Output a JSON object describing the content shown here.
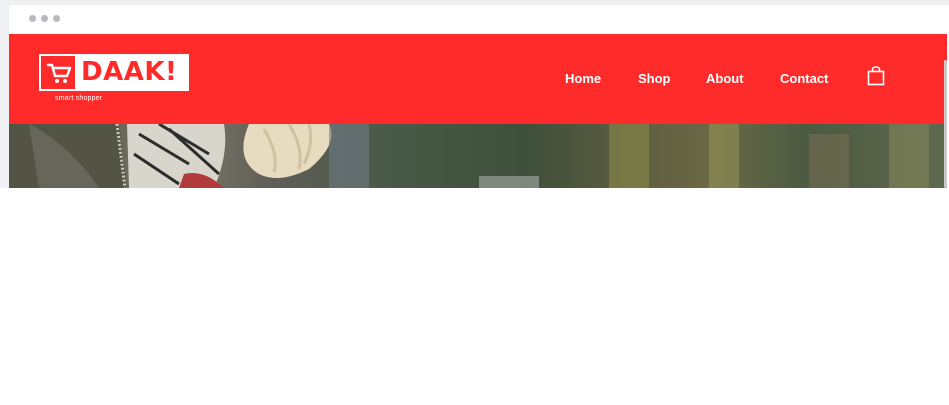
{
  "window": {
    "dots": [
      "dot",
      "dot",
      "dot"
    ]
  },
  "logo": {
    "name": "DAAK!",
    "tagline": "smart shopper",
    "icon": "cart-icon"
  },
  "nav": {
    "items": [
      {
        "label": "Home"
      },
      {
        "label": "Shop"
      },
      {
        "label": "About"
      },
      {
        "label": "Contact"
      }
    ],
    "bag_icon": "shopping-bag-icon"
  },
  "hero": {
    "image": "hero-photo"
  },
  "colors": {
    "brand_red": "#ff2a2a",
    "white": "#ffffff",
    "frame_grey": "#eef0f2"
  }
}
